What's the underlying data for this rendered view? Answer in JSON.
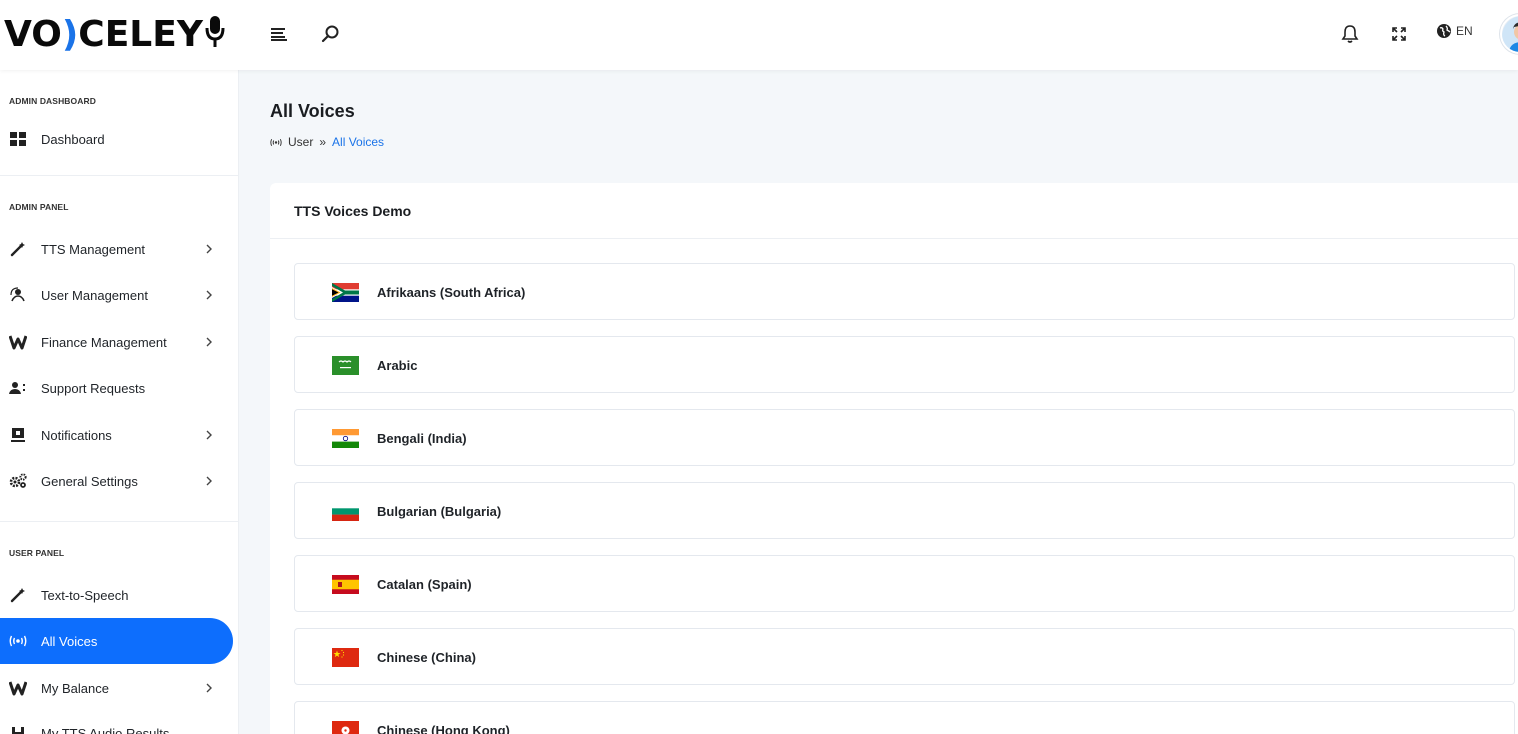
{
  "brand": {
    "logo_part1": "VO",
    "logo_part2": ")",
    "logo_part3": "CELEY"
  },
  "header": {
    "lang": "EN",
    "icons": [
      "menu-icon",
      "search-icon",
      "bell-icon",
      "fullscreen-icon",
      "globe-icon"
    ]
  },
  "sidebar": {
    "sections": [
      {
        "title": "ADMIN DASHBOARD",
        "items": [
          {
            "label": "Dashboard",
            "icon": "grid-icon",
            "chevron": false
          }
        ]
      },
      {
        "title": "ADMIN PANEL",
        "items": [
          {
            "label": "TTS Management",
            "icon": "magic-wand-icon",
            "chevron": true
          },
          {
            "label": "User Management",
            "icon": "user-cog-icon",
            "chevron": true
          },
          {
            "label": "Finance Management",
            "icon": "finance-icon",
            "chevron": true
          },
          {
            "label": "Support Requests",
            "icon": "support-user-icon",
            "chevron": false
          },
          {
            "label": "Notifications",
            "icon": "notification-icon",
            "chevron": true
          },
          {
            "label": "General Settings",
            "icon": "gears-icon",
            "chevron": true
          }
        ]
      },
      {
        "title": "USER PANEL",
        "items": [
          {
            "label": "Text-to-Speech",
            "icon": "magic-wand-icon",
            "chevron": false
          },
          {
            "label": "All Voices",
            "icon": "broadcast-icon",
            "chevron": false,
            "active": true
          },
          {
            "label": "My Balance",
            "icon": "finance-icon",
            "chevron": true
          },
          {
            "label": "My TTS Audio Results",
            "icon": "audio-results-icon",
            "chevron": false
          }
        ]
      }
    ]
  },
  "page": {
    "title": "All Voices",
    "breadcrumb": {
      "root": "User",
      "sep": "»",
      "current": "All Voices"
    }
  },
  "card": {
    "title": "TTS Voices Demo",
    "voices": [
      {
        "name": "Afrikaans (South Africa)",
        "flag": "south-africa-flag-icon"
      },
      {
        "name": "Arabic",
        "flag": "saudi-arabia-flag-icon"
      },
      {
        "name": "Bengali (India)",
        "flag": "india-flag-icon"
      },
      {
        "name": "Bulgarian (Bulgaria)",
        "flag": "bulgaria-flag-icon"
      },
      {
        "name": "Catalan (Spain)",
        "flag": "spain-flag-icon"
      },
      {
        "name": "Chinese (China)",
        "flag": "china-flag-icon"
      },
      {
        "name": "Chinese (Hong Kong)",
        "flag": "hong-kong-flag-icon"
      }
    ]
  },
  "colors": {
    "accent": "#0d6efd",
    "link": "#1a73e8",
    "background": "#f4f7fa"
  }
}
